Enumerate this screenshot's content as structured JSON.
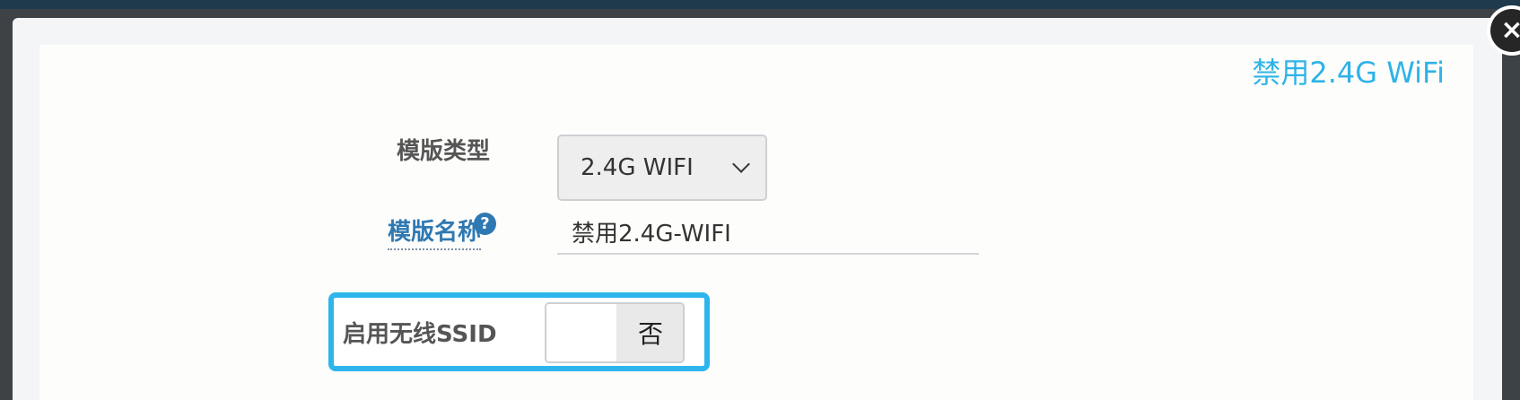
{
  "dialog": {
    "header_link": "禁用2.4G WiFi",
    "close_label": "×"
  },
  "form": {
    "template_type": {
      "label": "模版类型",
      "selected": "2.4G WIFI"
    },
    "template_name": {
      "label": "模版名称",
      "help_icon": "?",
      "value": "禁用2.4G-WIFI"
    },
    "ssid_enable": {
      "label": "启用无线SSID",
      "state": "否"
    }
  },
  "colors": {
    "accent": "#2db5ec",
    "link": "#2f79b3"
  }
}
